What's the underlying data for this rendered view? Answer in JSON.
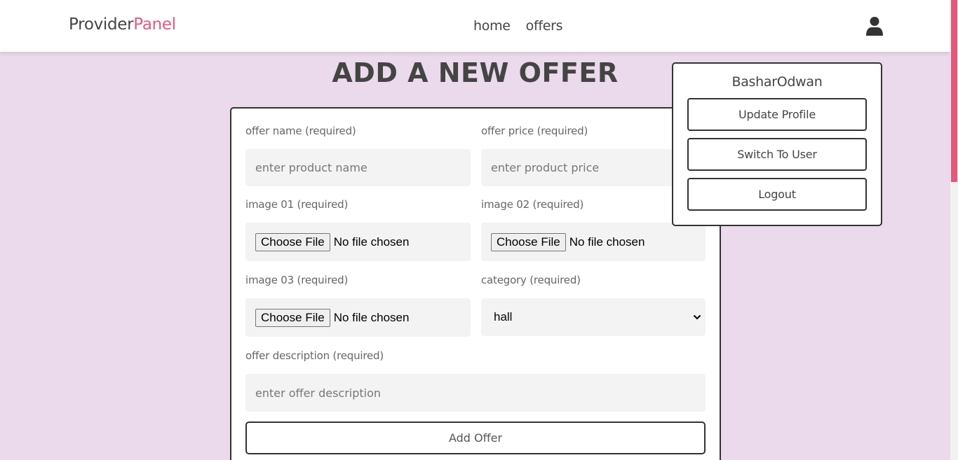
{
  "header": {
    "logo_main": "Provider",
    "logo_accent": "Panel",
    "nav": {
      "home": "home",
      "offers": "offers"
    },
    "accent_color": "#e8587a"
  },
  "page": {
    "title": "ADD A NEW OFFER",
    "background_color": "#ebdaeb"
  },
  "form": {
    "offer_name": {
      "label": "offer name (required)",
      "placeholder": "enter product name"
    },
    "offer_price": {
      "label": "offer price (required)",
      "placeholder": "enter product price"
    },
    "image_01": {
      "label": "image 01 (required)",
      "button": "Choose File",
      "status": "No file chosen"
    },
    "image_02": {
      "label": "image 02 (required)",
      "button": "Choose File",
      "status": "No file chosen"
    },
    "image_03": {
      "label": "image 03 (required)",
      "button": "Choose File",
      "status": "No file chosen"
    },
    "category": {
      "label": "category (required)",
      "selected": "hall"
    },
    "description": {
      "label": "offer description (required)",
      "placeholder": "enter offer description"
    },
    "submit_label": "Add Offer"
  },
  "user_menu": {
    "username": "BasharOdwan",
    "update_profile": "Update Profile",
    "switch_to_user": "Switch To User",
    "logout": "Logout"
  },
  "icons": {
    "user": "user-icon",
    "select_arrow": "chevron-down-icon"
  }
}
